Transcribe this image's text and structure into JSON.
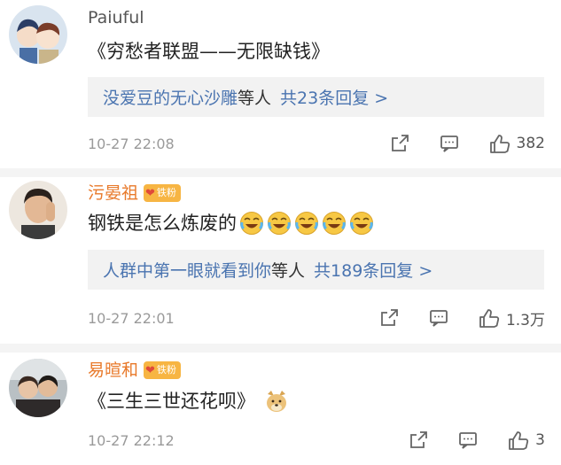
{
  "comments": [
    {
      "username": "Paiuful",
      "has_fan_badge": false,
      "text": "《穷愁者联盟——无限缺钱》",
      "reply": {
        "names": "没爱豆的无心沙雕",
        "sep": "等人",
        "count": "共23条回复 >"
      },
      "time": "10-27 22:08",
      "likes": "382"
    },
    {
      "username": "污晏祖",
      "has_fan_badge": true,
      "badge_label": "铁粉",
      "text": "钢铁是怎么炼废的",
      "emoji_icon": "laugh-cry-emoji",
      "emoji_count": 5,
      "reply": {
        "names": "人群中第一眼就看到你",
        "sep": "等人",
        "count": "共189条回复 >"
      },
      "time": "10-27 22:01",
      "likes": "1.3万"
    },
    {
      "username": "易暄和",
      "has_fan_badge": true,
      "badge_label": "铁粉",
      "text": "《三生三世还花呗》",
      "emoji_icon": "doge-emoji",
      "time": "10-27 22:12",
      "likes": "3"
    }
  ],
  "colors": {
    "username_orange": "#e8792a",
    "reply_link": "#4a74b0",
    "badge": "#f7b543",
    "reply_bg": "#f2f2f2"
  }
}
